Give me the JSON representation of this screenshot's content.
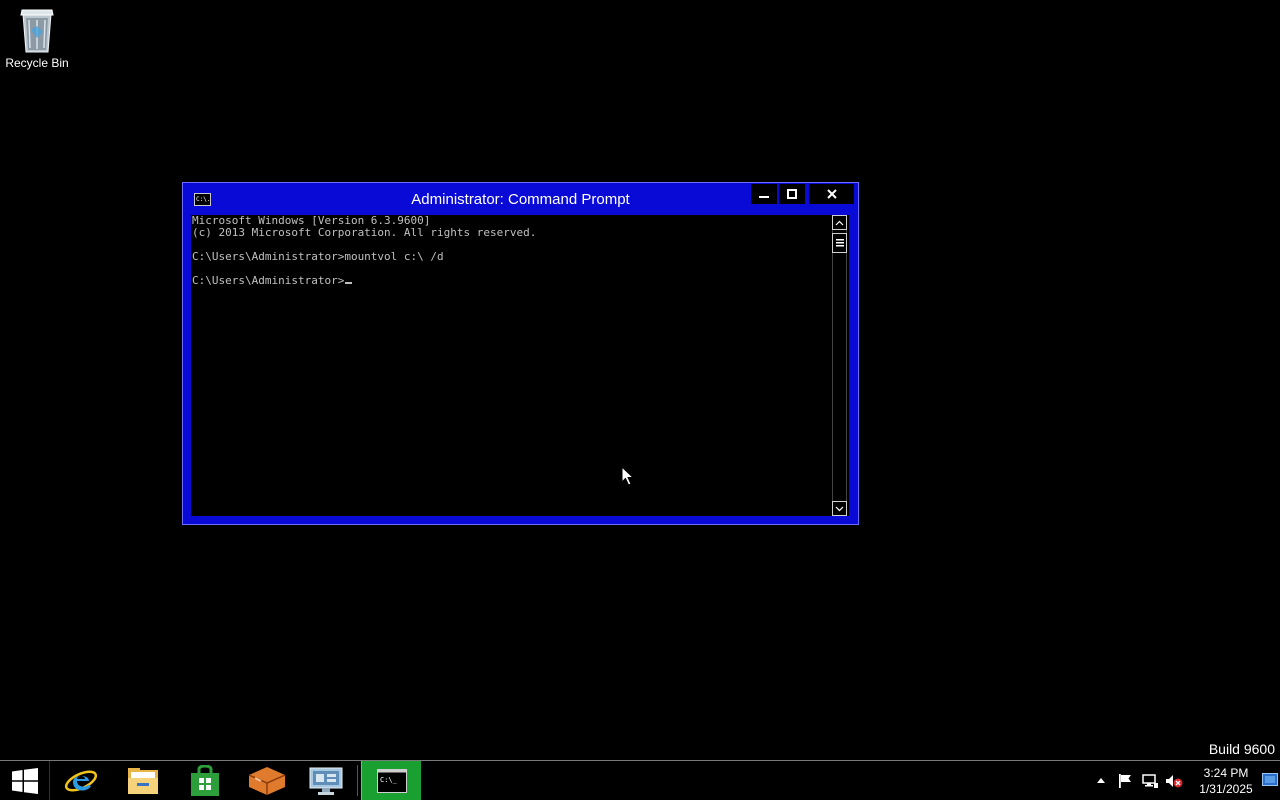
{
  "desktop": {
    "icons": [
      {
        "label": "Recycle Bin",
        "icon": "recycle-bin-icon"
      }
    ],
    "watermark": "Build 9600"
  },
  "window": {
    "title": "Administrator: Command Prompt",
    "app_icon": "console-icon",
    "app_icon_text": "C:\\.",
    "title_bar_color": "#0a0ad6",
    "controls": [
      "minimize-icon",
      "maximize-icon",
      "close-icon"
    ],
    "console": {
      "lines": [
        "Microsoft Windows [Version 6.3.9600]",
        "(c) 2013 Microsoft Corporation. All rights reserved.",
        "",
        "C:\\Users\\Administrator>mountvol c:\\ /d",
        "",
        "C:\\Users\\Administrator>"
      ]
    }
  },
  "taskbar": {
    "pinned": [
      {
        "name": "start",
        "icon": "windows-logo-icon"
      },
      {
        "name": "internet-explorer",
        "icon": "internet-explorer-icon"
      },
      {
        "name": "file-explorer",
        "icon": "folder-icon"
      },
      {
        "name": "store",
        "icon": "store-bag-icon"
      },
      {
        "name": "app",
        "icon": "orange-box-icon"
      },
      {
        "name": "server-manager",
        "icon": "server-manager-icon"
      },
      {
        "name": "command-prompt",
        "icon": "console-icon",
        "active": true
      }
    ],
    "cmd_icon_text": "C:\\_",
    "active_color": "#1aa030",
    "tray": {
      "icons": [
        "chevron-up-icon",
        "action-center-flag-icon",
        "network-icon",
        "volume-muted-icon"
      ],
      "time": "3:24 PM",
      "date": "1/31/2025"
    }
  }
}
